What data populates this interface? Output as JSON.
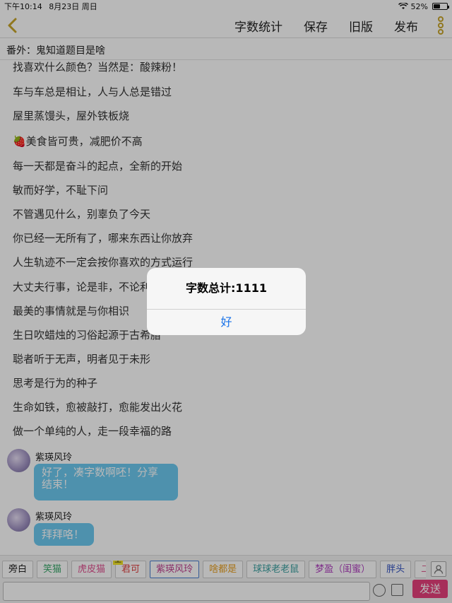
{
  "status": {
    "time": "下午10:14",
    "date": "8月23日 周日",
    "battery": "52%",
    "battery_level": 0.52
  },
  "toolbar": {
    "items": [
      "字数统计",
      "保存",
      "旧版",
      "发布"
    ]
  },
  "title": "番外：鬼知道题目是啥",
  "lines": [
    "找喜欢什么颜色？当然是：酸辣粉！",
    "车与车总是相让，人与人总是错过",
    "屋里蒸馒头，屋外铁板烧",
    "🍓美食皆可贵，减肥价不高",
    "每一天都是奋斗的起点，全新的开始",
    "敏而好学，不耻下问",
    "不管遇见什么，别辜负了今天",
    "你已经一无所有了，哪来东西让你放弃",
    "人生轨迹不一定会按你喜欢的方式运行",
    "大丈夫行事，论是非，不论利害",
    "最美的事情就是与你相识",
    "生日吹蜡烛的习俗起源于古希腊",
    "聪者听于无声，明者见于未形",
    "思考是行为的种子",
    "生命如铁，愈被敲打，愈能发出火花",
    "做一个单纯的人，走一段幸福的路"
  ],
  "messages": [
    {
      "user": "紫瑛风玲",
      "text": "好了，凑字数啊呸！分享\n结束！"
    },
    {
      "user": "紫瑛风玲",
      "text": "拜拜咯！"
    }
  ],
  "chips": [
    {
      "label": "旁白",
      "color": "#222222"
    },
    {
      "label": "笑猫",
      "color": "#3aa86b"
    },
    {
      "label": "虎皮猫",
      "color": "#e0508f"
    },
    {
      "label": "君可",
      "color": "#e04040",
      "badge": "主"
    },
    {
      "label": "紫瑛风玲",
      "color": "#c04090"
    },
    {
      "label": "啥都是",
      "color": "#e8a020"
    },
    {
      "label": "球球老老鼠",
      "color": "#3aa0a0"
    },
    {
      "label": "梦盈（闺蜜）",
      "color": "#b040c0"
    },
    {
      "label": "胖头",
      "color": "#3050c0"
    },
    {
      "label": "二丫",
      "color": "#e06090"
    }
  ],
  "input": {
    "placeholder": ""
  },
  "send_label": "发送",
  "alert": {
    "title": "字数总计:1111",
    "button": "好"
  }
}
